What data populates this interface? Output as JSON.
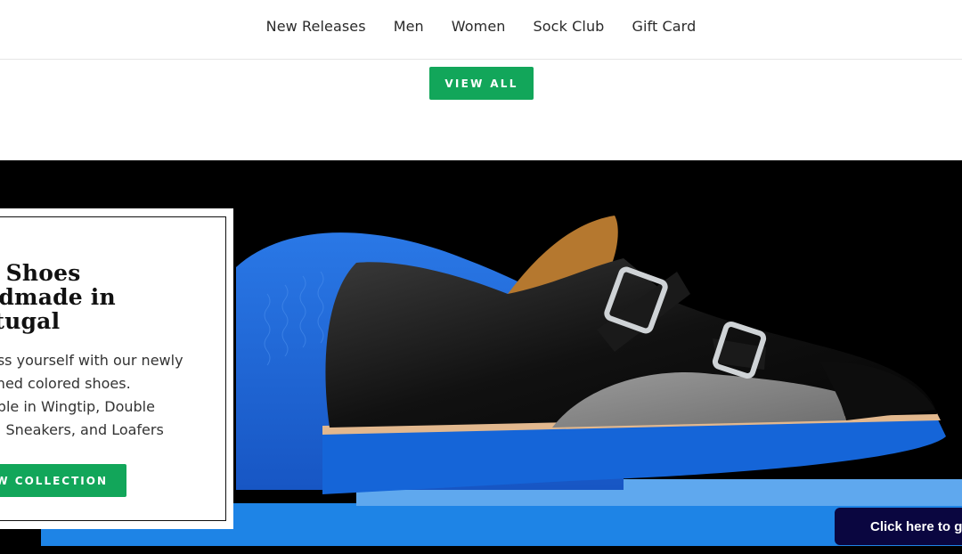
{
  "nav": {
    "items": [
      {
        "label": "New Releases"
      },
      {
        "label": "Men"
      },
      {
        "label": "Women"
      },
      {
        "label": "Sock Club"
      },
      {
        "label": "Gift Card"
      }
    ]
  },
  "view_all": {
    "label": "VIEW ALL"
  },
  "promo": {
    "title_line1": "d Shoes",
    "title_line2": "ndmade in",
    "title_line3": "rtugal",
    "body_line1": "ess yourself with our newly",
    "body_line2": "ched colored shoes.",
    "body_line3": "able in Wingtip, Double",
    "body_line4": "k, Sneakers, and Loafers",
    "cta_label": "W COLLECTION"
  },
  "chat": {
    "label": "Click here to ge"
  },
  "colors": {
    "accent": "#12a65a",
    "sole": "#1565d8",
    "chat_bg": "#0a0640"
  }
}
